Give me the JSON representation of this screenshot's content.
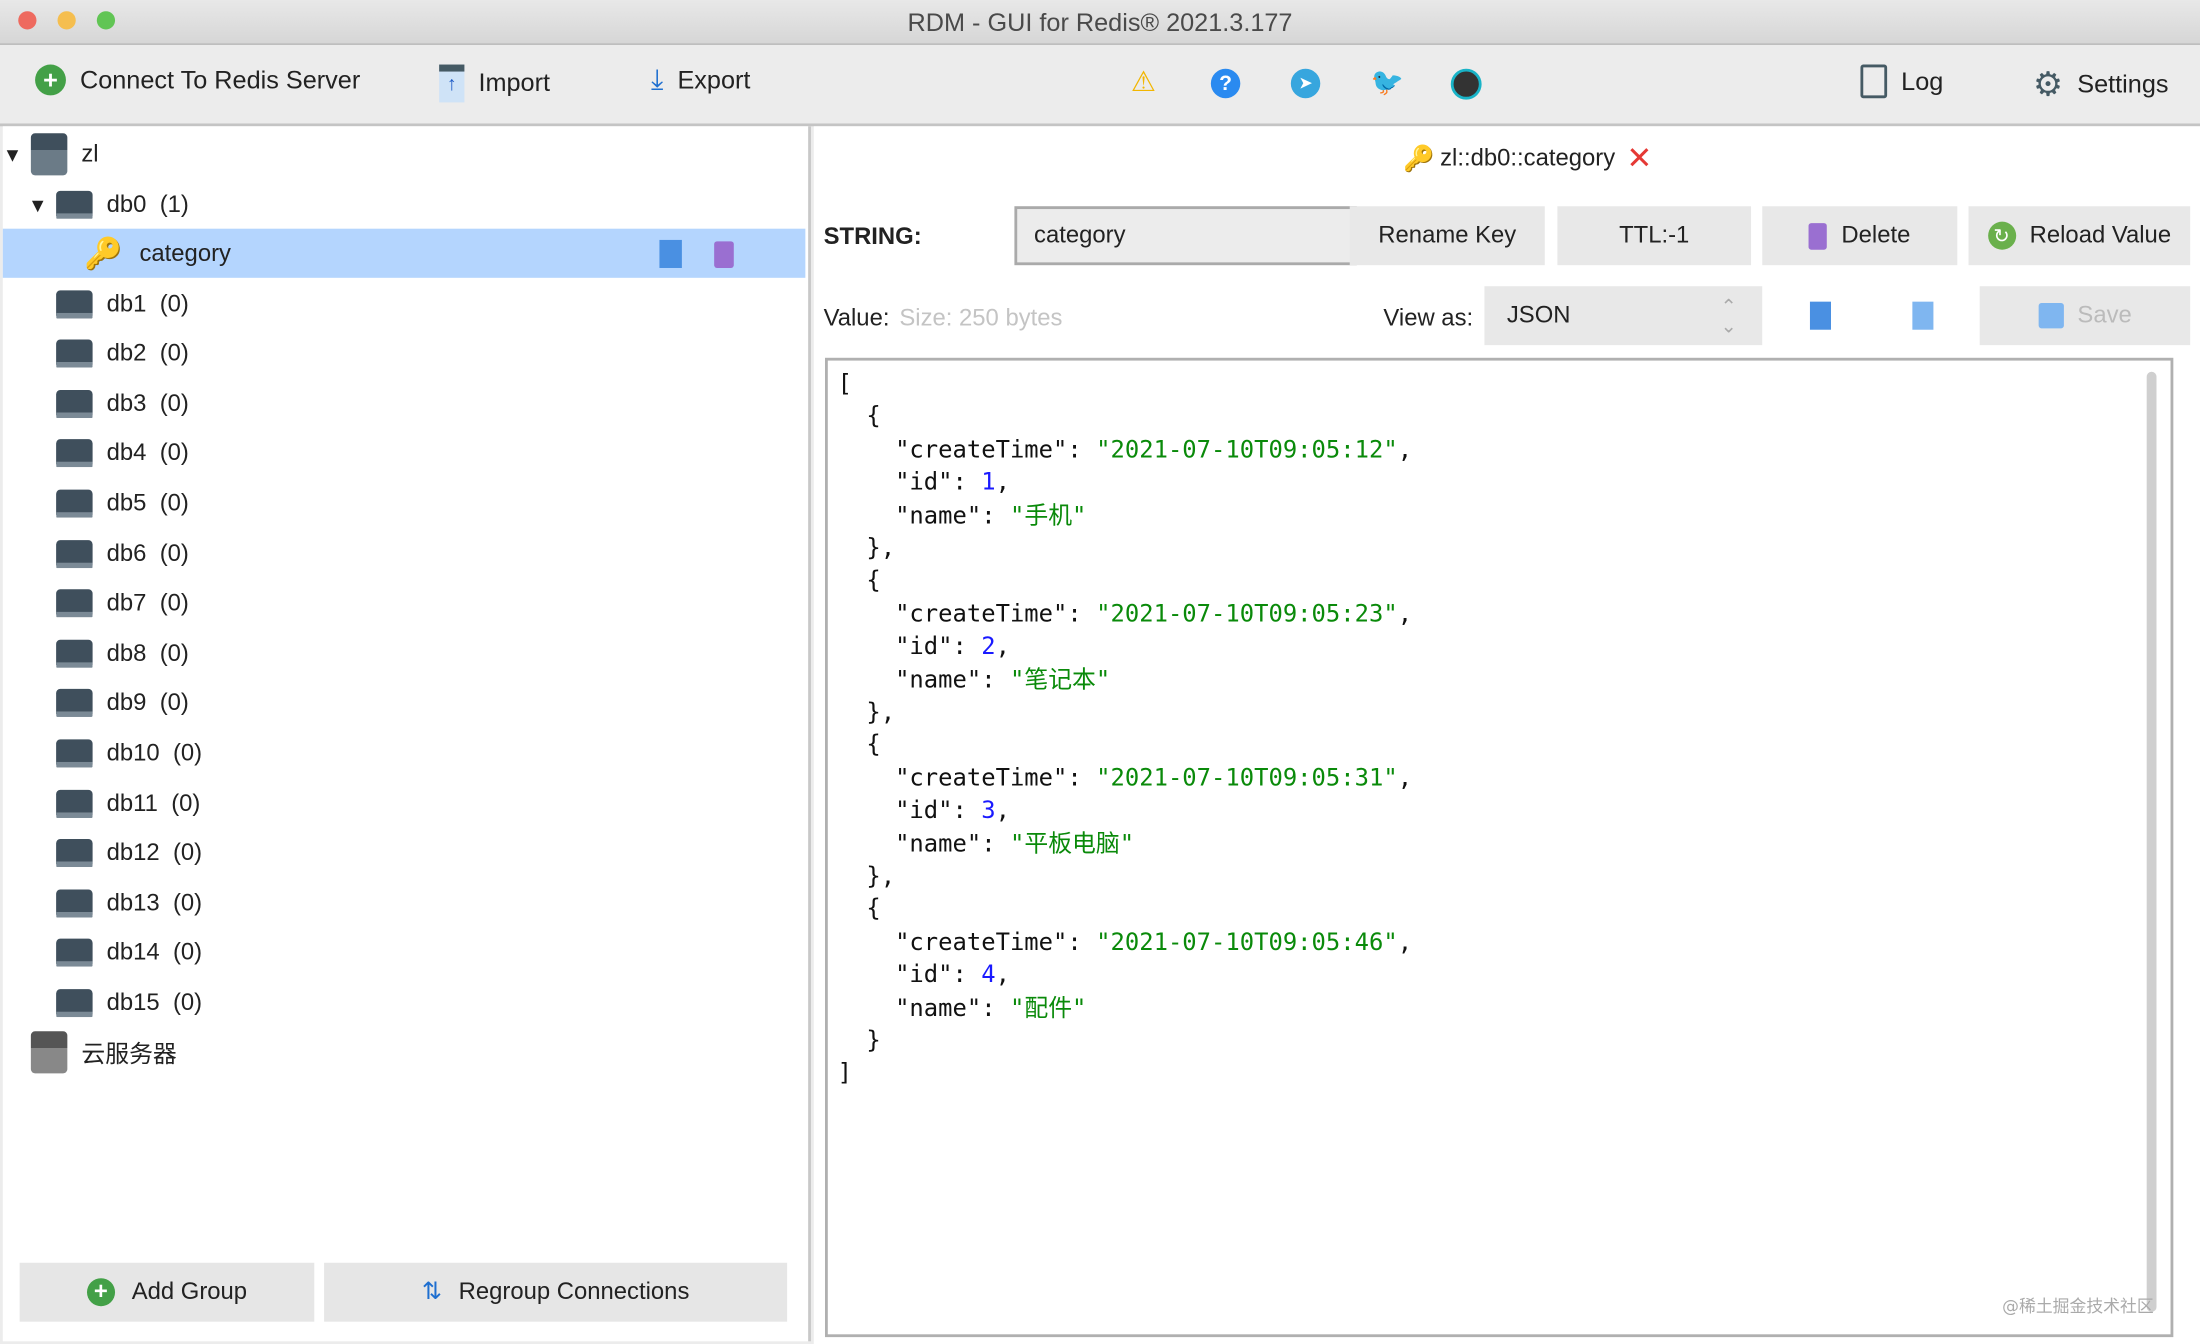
{
  "window": {
    "title": "RDM - GUI for Redis® 2021.3.177"
  },
  "toolbar": {
    "connect": "Connect To Redis Server",
    "import": "Import",
    "export": "Export",
    "log": "Log",
    "settings": "Settings",
    "icons": [
      "warning-icon",
      "help-icon",
      "telegram-icon",
      "twitter-icon",
      "github-icon"
    ]
  },
  "tree": {
    "connection": "zl",
    "db0": {
      "name": "db0",
      "count": "(1)"
    },
    "key": "category",
    "dbs": [
      {
        "name": "db1",
        "count": "(0)"
      },
      {
        "name": "db2",
        "count": "(0)"
      },
      {
        "name": "db3",
        "count": "(0)"
      },
      {
        "name": "db4",
        "count": "(0)"
      },
      {
        "name": "db5",
        "count": "(0)"
      },
      {
        "name": "db6",
        "count": "(0)"
      },
      {
        "name": "db7",
        "count": "(0)"
      },
      {
        "name": "db8",
        "count": "(0)"
      },
      {
        "name": "db9",
        "count": "(0)"
      },
      {
        "name": "db10",
        "count": "(0)"
      },
      {
        "name": "db11",
        "count": "(0)"
      },
      {
        "name": "db12",
        "count": "(0)"
      },
      {
        "name": "db13",
        "count": "(0)"
      },
      {
        "name": "db14",
        "count": "(0)"
      },
      {
        "name": "db15",
        "count": "(0)"
      }
    ],
    "connection2": "云服务器"
  },
  "left_footer": {
    "add_group": "Add Group",
    "regroup": "Regroup Connections"
  },
  "tab": {
    "label": "zl::db0::category"
  },
  "key_view": {
    "type_label": "STRING:",
    "key_name": "category",
    "rename": "Rename Key",
    "ttl": "TTL:-1",
    "delete": "Delete",
    "reload": "Reload Value",
    "value_label": "Value:",
    "size": "Size: 250 bytes",
    "view_as_label": "View as:",
    "view_as": "JSON",
    "save": "Save"
  },
  "value": [
    {
      "createTime": "2021-07-10T09:05:12",
      "id": 1,
      "name": "手机"
    },
    {
      "createTime": "2021-07-10T09:05:23",
      "id": 2,
      "name": "笔记本"
    },
    {
      "createTime": "2021-07-10T09:05:31",
      "id": 3,
      "name": "平板电脑"
    },
    {
      "createTime": "2021-07-10T09:05:46",
      "id": 4,
      "name": "配件"
    }
  ],
  "watermark": "@稀土掘金技术社区",
  "colors": {
    "selection": "#b4d5fe",
    "string": "#0a8a0a",
    "number": "#1a1aff",
    "key_icon": "#f5a623",
    "close": "#e53935"
  }
}
